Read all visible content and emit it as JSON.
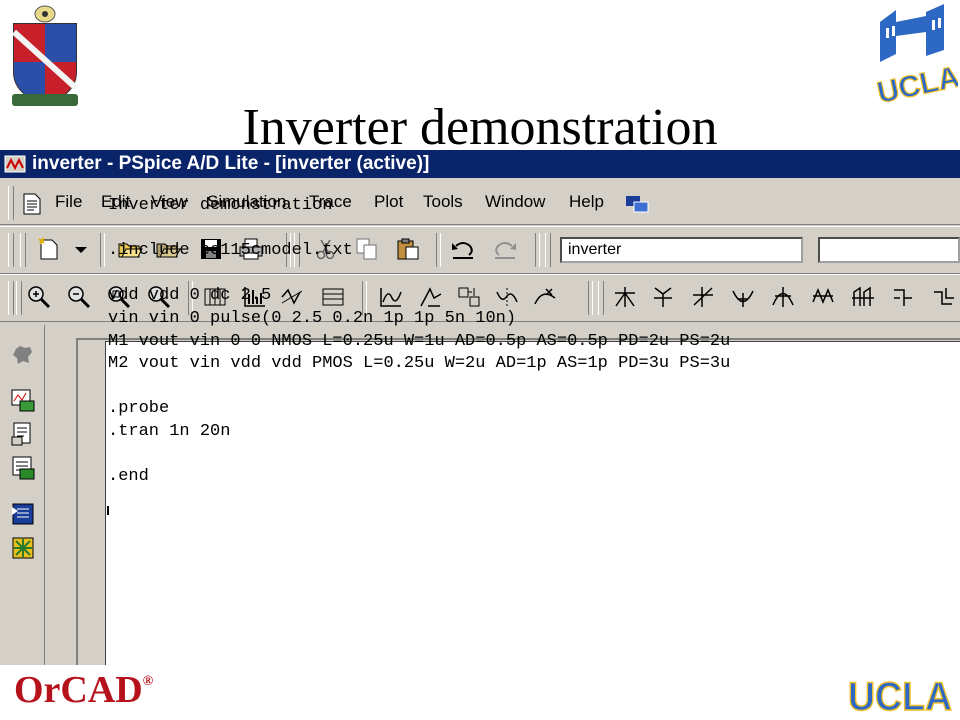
{
  "slide": {
    "title": "Inverter demonstration"
  },
  "logos": {
    "top_left": "university-crest",
    "top_right_text": "UCLA",
    "bottom_left_text": "OrCAD",
    "bottom_left_mark": "®",
    "bottom_right_text": "UCLA"
  },
  "window": {
    "title": "inverter - PSpice A/D Lite - [inverter (active)]"
  },
  "menu": {
    "items": [
      "File",
      "Edit",
      "View",
      "Simulation",
      "Trace",
      "Plot",
      "Tools",
      "Window",
      "Help"
    ]
  },
  "toolbar": {
    "simulation_combo": "inverter",
    "second_combo": ""
  },
  "editor": {
    "lines": [
      "Inverter demonstration",
      "",
      ".include ee115cmodel.txt",
      "",
      "vdd vdd 0 dc 2.5",
      "vin vin 0 pulse(0 2.5 0.2n 1p 1p 5n 10n)",
      "M1 vout vin 0 0 NMOS L=0.25u W=1u AD=0.5p AS=0.5p PD=2u PS=2u",
      "M2 vout vin vdd vdd PMOS L=0.25u W=2u AD=1p AS=1p PD=3u PS=3u",
      "",
      ".probe",
      ".tran 1n 20n",
      "",
      ".end"
    ]
  },
  "colors": {
    "titlebar": "#0a246a",
    "chrome": "#d4d0c8",
    "orcad_red": "#b5121b",
    "ucla_blue": "#2d68c4"
  }
}
